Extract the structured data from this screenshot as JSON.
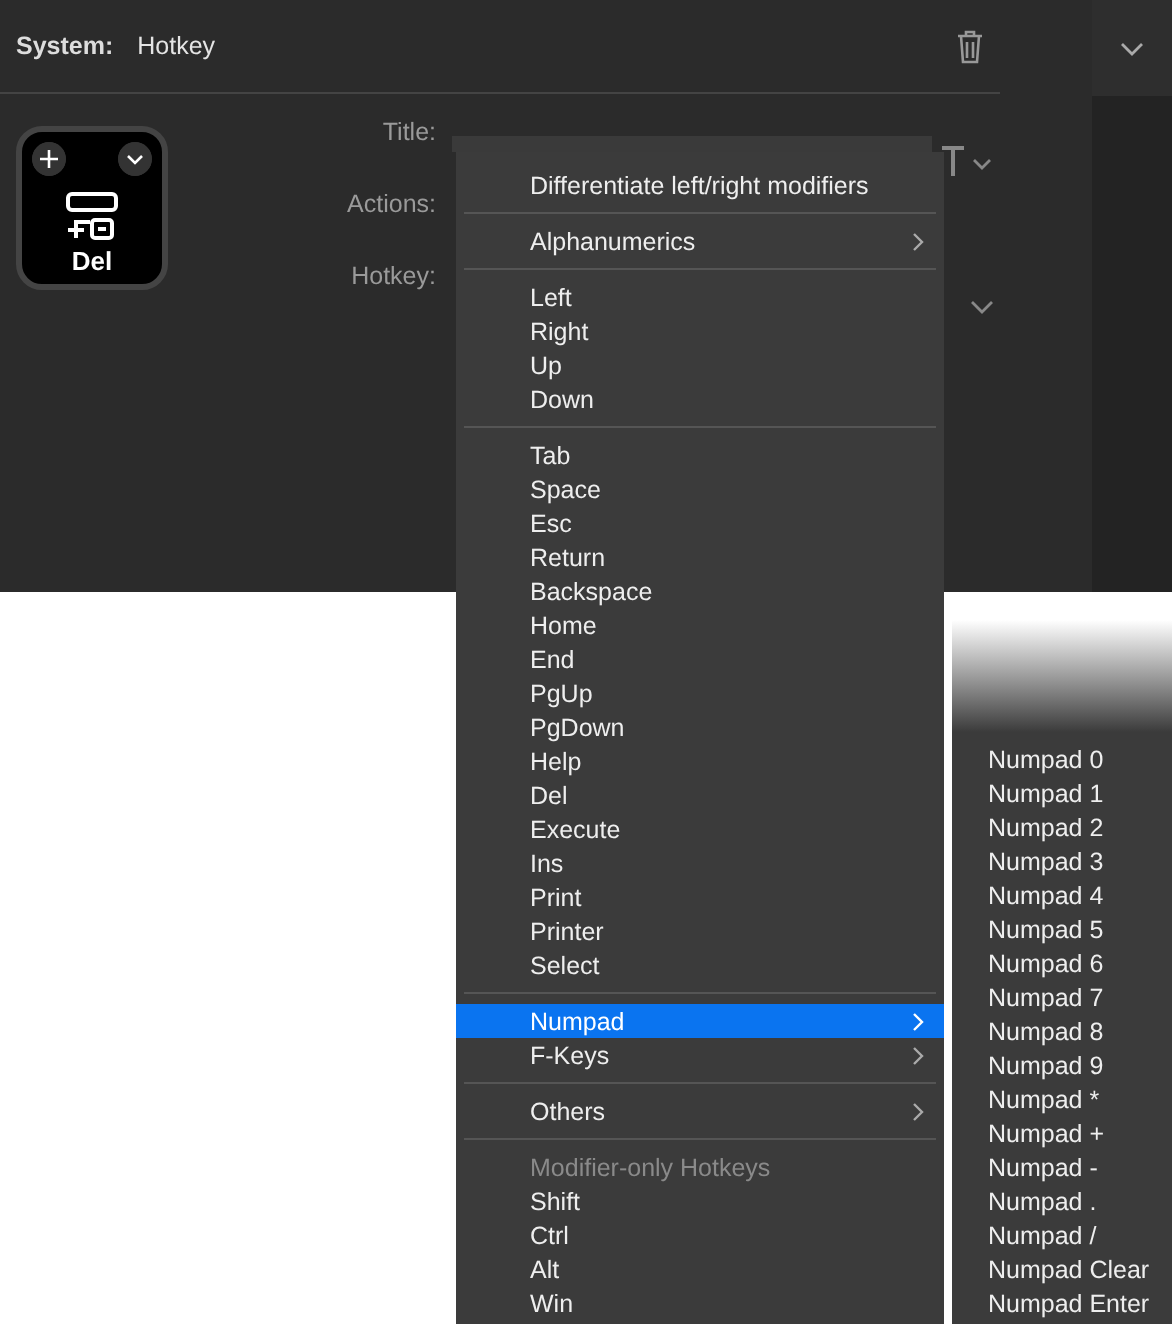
{
  "header": {
    "label": "System:",
    "value": "Hotkey"
  },
  "key_tile": {
    "caption": "Del"
  },
  "form": {
    "fields": [
      {
        "label": "Title:"
      },
      {
        "label": "Actions:"
      },
      {
        "label": "Hotkey:"
      }
    ]
  },
  "menu": {
    "entries": [
      {
        "kind": "item",
        "label": "Differentiate left/right modifiers",
        "selected": false
      },
      {
        "kind": "separator"
      },
      {
        "kind": "submenu",
        "label": "Alphanumerics",
        "selected": false
      },
      {
        "kind": "separator"
      },
      {
        "kind": "item",
        "label": "Left",
        "selected": false
      },
      {
        "kind": "item",
        "label": "Right",
        "selected": false
      },
      {
        "kind": "item",
        "label": "Up",
        "selected": false
      },
      {
        "kind": "item",
        "label": "Down",
        "selected": false
      },
      {
        "kind": "separator"
      },
      {
        "kind": "item",
        "label": "Tab",
        "selected": false
      },
      {
        "kind": "item",
        "label": "Space",
        "selected": false
      },
      {
        "kind": "item",
        "label": "Esc",
        "selected": false
      },
      {
        "kind": "item",
        "label": "Return",
        "selected": false
      },
      {
        "kind": "item",
        "label": "Backspace",
        "selected": false
      },
      {
        "kind": "item",
        "label": "Home",
        "selected": false
      },
      {
        "kind": "item",
        "label": "End",
        "selected": false
      },
      {
        "kind": "item",
        "label": "PgUp",
        "selected": false
      },
      {
        "kind": "item",
        "label": "PgDown",
        "selected": false
      },
      {
        "kind": "item",
        "label": "Help",
        "selected": false
      },
      {
        "kind": "item",
        "label": "Del",
        "selected": false
      },
      {
        "kind": "item",
        "label": "Execute",
        "selected": false
      },
      {
        "kind": "item",
        "label": "Ins",
        "selected": false
      },
      {
        "kind": "item",
        "label": "Print",
        "selected": false
      },
      {
        "kind": "item",
        "label": "Printer",
        "selected": false
      },
      {
        "kind": "item",
        "label": "Select",
        "selected": false
      },
      {
        "kind": "separator"
      },
      {
        "kind": "submenu",
        "label": "Numpad",
        "selected": true
      },
      {
        "kind": "submenu",
        "label": "F-Keys",
        "selected": false
      },
      {
        "kind": "separator"
      },
      {
        "kind": "submenu",
        "label": "Others",
        "selected": false
      },
      {
        "kind": "separator"
      },
      {
        "kind": "header",
        "label": "Modifier-only Hotkeys"
      },
      {
        "kind": "item",
        "label": "Shift",
        "selected": false
      },
      {
        "kind": "item",
        "label": "Ctrl",
        "selected": false
      },
      {
        "kind": "item",
        "label": "Alt",
        "selected": false
      },
      {
        "kind": "item",
        "label": "Win",
        "selected": false
      }
    ]
  },
  "submenu": {
    "items": [
      "Numpad 0",
      "Numpad 1",
      "Numpad 2",
      "Numpad 3",
      "Numpad 4",
      "Numpad 5",
      "Numpad 6",
      "Numpad 7",
      "Numpad 8",
      "Numpad 9",
      "Numpad *",
      "Numpad +",
      "Numpad -",
      "Numpad .",
      "Numpad /",
      "Numpad Clear",
      "Numpad Enter"
    ]
  }
}
